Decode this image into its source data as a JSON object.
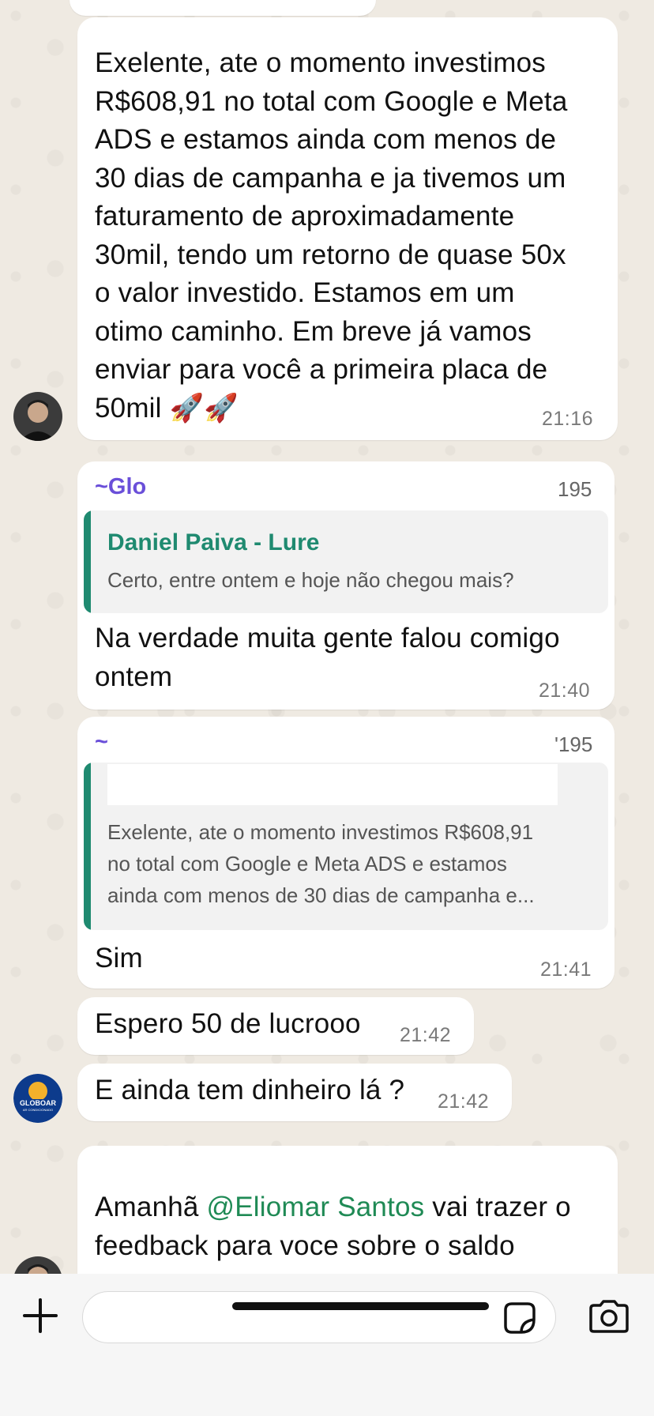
{
  "messages": {
    "m1": {
      "lines": [
        "Exelente, ate o momento investimos",
        "R$608,91 no total com Google e Meta",
        "ADS e estamos ainda com menos de",
        "30 dias de campanha e ja tivemos um",
        "faturamento de aproximadamente",
        "30mil, tendo um retorno de quase 50x",
        "o valor investido. Estamos em um",
        "otimo caminho. Em breve já vamos",
        "enviar para você a primeira placa de",
        "50mil 🚀🚀"
      ],
      "time": "21:16"
    },
    "m2": {
      "sender": "~Glo",
      "phone_fragment": "195",
      "quote_author": "Daniel Paiva - Lure",
      "quote_text": "Certo, entre ontem e hoje não chegou mais?",
      "lines": [
        "Na verdade muita gente falou comigo",
        "ontem"
      ],
      "time": "21:40"
    },
    "m3": {
      "sender": "~",
      "phone_fragment": "'195",
      "quote_lines": [
        "Exelente, ate o momento investimos R$608,91",
        "no total com Google e Meta ADS e estamos",
        "ainda com menos de 30 dias de campanha e..."
      ],
      "text": "Sim",
      "time": "21:41"
    },
    "m4": {
      "text": "Espero 50 de lucrooo",
      "time": "21:42"
    },
    "m5": {
      "text": "E ainda tem dinheiro lá ?",
      "time": "21:42"
    },
    "m6": {
      "line1_before": "Amanhã ",
      "mention": "@Eliomar Santos",
      "line1_after": " vai trazer o",
      "line2": "feedback para voce sobre o saldo"
    }
  },
  "avatars": {
    "globoar": {
      "title": "GLOBOAR",
      "subtitle": "AR CONDICIONADO"
    }
  },
  "input": {
    "placeholder": ""
  },
  "icons": [
    "plus-icon",
    "sticker-icon",
    "camera-icon"
  ],
  "colors": {
    "chat_background": "#efeae2",
    "bubble": "#ffffff",
    "sender_name": "#6a4fd9",
    "quote_accent": "#1f8a70",
    "mention": "#1f8a55"
  }
}
